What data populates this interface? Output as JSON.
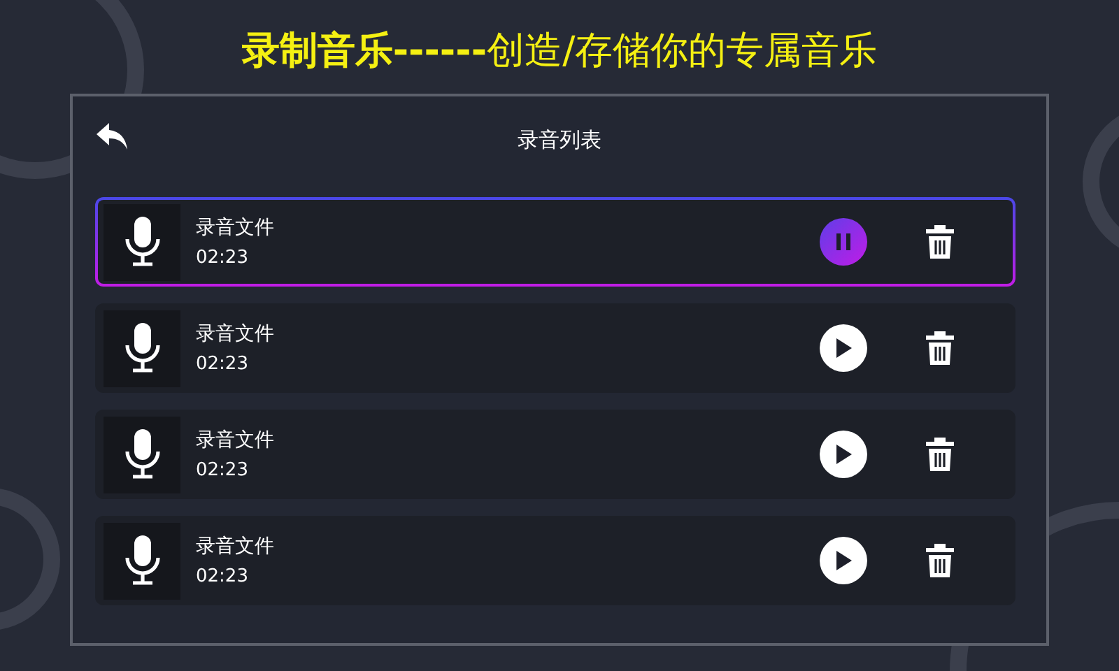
{
  "header": {
    "title": "**录制音乐------**创造/存储你的专属音乐"
  },
  "panel": {
    "title": "录音列表",
    "recordings": [
      {
        "name": "录音文件",
        "duration": "02:23",
        "playing": true
      },
      {
        "name": "录音文件",
        "duration": "02:23",
        "playing": false
      },
      {
        "name": "录音文件",
        "duration": "02:23",
        "playing": false
      },
      {
        "name": "录音文件",
        "duration": "02:23",
        "playing": false
      }
    ]
  }
}
